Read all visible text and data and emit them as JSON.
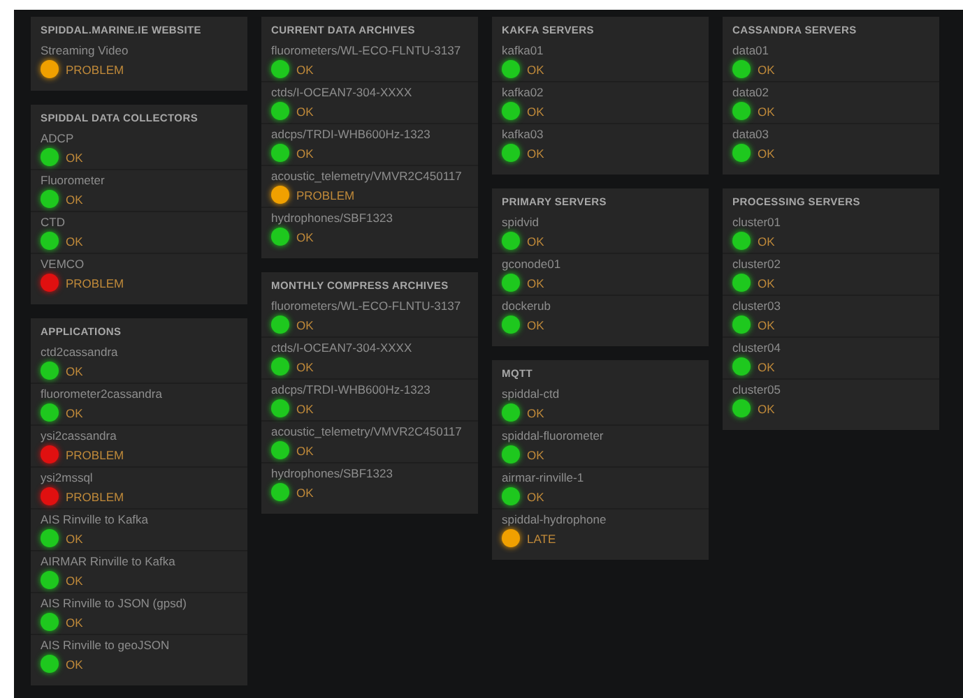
{
  "columns": [
    {
      "panels": [
        {
          "title": "SPIDDAL.MARINE.IE WEBSITE",
          "items": [
            {
              "name": "Streaming Video",
              "status": "PROBLEM",
              "color": "#f0a000"
            }
          ]
        },
        {
          "title": "SPIDDAL DATA COLLECTORS",
          "items": [
            {
              "name": "ADCP",
              "status": "OK",
              "color": "#1ec81e"
            },
            {
              "name": "Fluorometer",
              "status": "OK",
              "color": "#1ec81e"
            },
            {
              "name": "CTD",
              "status": "OK",
              "color": "#1ec81e"
            },
            {
              "name": "VEMCO",
              "status": "PROBLEM",
              "color": "#e01010"
            }
          ]
        },
        {
          "title": "APPLICATIONS",
          "items": [
            {
              "name": "ctd2cassandra",
              "status": "OK",
              "color": "#1ec81e"
            },
            {
              "name": "fluorometer2cassandra",
              "status": "OK",
              "color": "#1ec81e"
            },
            {
              "name": "ysi2cassandra",
              "status": "PROBLEM",
              "color": "#e01010"
            },
            {
              "name": "ysi2mssql",
              "status": "PROBLEM",
              "color": "#e01010"
            },
            {
              "name": "AIS Rinville to Kafka",
              "status": "OK",
              "color": "#1ec81e"
            },
            {
              "name": "AIRMAR Rinville to Kafka",
              "status": "OK",
              "color": "#1ec81e"
            },
            {
              "name": "AIS Rinville to JSON (gpsd)",
              "status": "OK",
              "color": "#1ec81e"
            },
            {
              "name": "AIS Rinville to geoJSON",
              "status": "OK",
              "color": "#1ec81e"
            }
          ]
        }
      ]
    },
    {
      "panels": [
        {
          "title": "CURRENT DATA ARCHIVES",
          "items": [
            {
              "name": "fluorometers/WL-ECO-FLNTU-3137",
              "status": "OK",
              "color": "#1ec81e"
            },
            {
              "name": "ctds/I-OCEAN7-304-XXXX",
              "status": "OK",
              "color": "#1ec81e"
            },
            {
              "name": "adcps/TRDI-WHB600Hz-1323",
              "status": "OK",
              "color": "#1ec81e"
            },
            {
              "name": "acoustic_telemetry/VMVR2C450117",
              "status": "PROBLEM",
              "color": "#f0a000"
            },
            {
              "name": "hydrophones/SBF1323",
              "status": "OK",
              "color": "#1ec81e"
            }
          ]
        },
        {
          "title": "MONTHLY COMPRESS ARCHIVES",
          "items": [
            {
              "name": "fluorometers/WL-ECO-FLNTU-3137",
              "status": "OK",
              "color": "#1ec81e"
            },
            {
              "name": "ctds/I-OCEAN7-304-XXXX",
              "status": "OK",
              "color": "#1ec81e"
            },
            {
              "name": "adcps/TRDI-WHB600Hz-1323",
              "status": "OK",
              "color": "#1ec81e"
            },
            {
              "name": "acoustic_telemetry/VMVR2C450117",
              "status": "OK",
              "color": "#1ec81e"
            },
            {
              "name": "hydrophones/SBF1323",
              "status": "OK",
              "color": "#1ec81e"
            }
          ]
        }
      ]
    },
    {
      "panels": [
        {
          "title": "KAKFA SERVERS",
          "items": [
            {
              "name": "kafka01",
              "status": "OK",
              "color": "#1ec81e"
            },
            {
              "name": "kafka02",
              "status": "OK",
              "color": "#1ec81e"
            },
            {
              "name": "kafka03",
              "status": "OK",
              "color": "#1ec81e"
            }
          ]
        },
        {
          "title": "PRIMARY SERVERS",
          "items": [
            {
              "name": "spidvid",
              "status": "OK",
              "color": "#1ec81e"
            },
            {
              "name": "gconode01",
              "status": "OK",
              "color": "#1ec81e"
            },
            {
              "name": "dockerub",
              "status": "OK",
              "color": "#1ec81e"
            }
          ]
        },
        {
          "title": "MQTT",
          "items": [
            {
              "name": "spiddal-ctd",
              "status": "OK",
              "color": "#1ec81e"
            },
            {
              "name": "spiddal-fluorometer",
              "status": "OK",
              "color": "#1ec81e"
            },
            {
              "name": "airmar-rinville-1",
              "status": "OK",
              "color": "#1ec81e"
            },
            {
              "name": "spiddal-hydrophone",
              "status": "LATE",
              "color": "#f0a000"
            }
          ]
        }
      ]
    },
    {
      "panels": [
        {
          "title": "CASSANDRA SERVERS",
          "items": [
            {
              "name": "data01",
              "status": "OK",
              "color": "#1ec81e"
            },
            {
              "name": "data02",
              "status": "OK",
              "color": "#1ec81e"
            },
            {
              "name": "data03",
              "status": "OK",
              "color": "#1ec81e"
            }
          ]
        },
        {
          "title": "PROCESSING SERVERS",
          "items": [
            {
              "name": "cluster01",
              "status": "OK",
              "color": "#1ec81e"
            },
            {
              "name": "cluster02",
              "status": "OK",
              "color": "#1ec81e"
            },
            {
              "name": "cluster03",
              "status": "OK",
              "color": "#1ec81e"
            },
            {
              "name": "cluster04",
              "status": "OK",
              "color": "#1ec81e"
            },
            {
              "name": "cluster05",
              "status": "OK",
              "color": "#1ec81e"
            }
          ]
        }
      ]
    }
  ]
}
